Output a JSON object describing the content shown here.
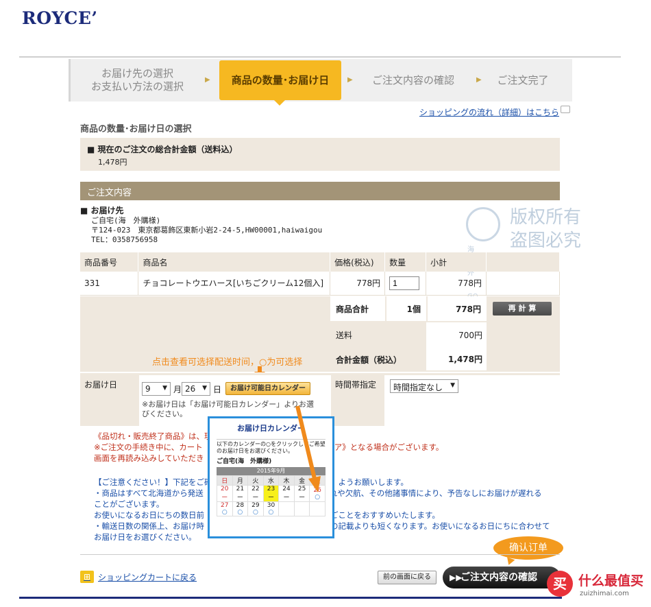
{
  "logo": "ROYCE’",
  "steps": {
    "s1_line1": "お届け先の選択",
    "s1_line2": "お支払い方法の選択",
    "s2": "商品の数量･お届け日",
    "s3": "ご注文内容の確認",
    "s4": "ご注文完了"
  },
  "flow_link": "ショッピングの流れ（詳細）はこちら",
  "section_title": "商品の数量･お届け日の選択",
  "total": {
    "heading": "■ 現在のご注文の総合計金額（送料込）",
    "value": "1,478円"
  },
  "order_heading": "ご注文内容",
  "destination": {
    "heading": "■ お届け先",
    "name": "ご自宅(海　外購様)",
    "address": "〒124-023　東京都葛飾区東新小岩2-24-5,HW00001,haiwaigou",
    "tel": "TEL：0358756958"
  },
  "watermark": {
    "line1": "版权所有",
    "line2": "盗图必究",
    "brand": "海外GO"
  },
  "table": {
    "headers": [
      "商品番号",
      "商品名",
      "価格(税込)",
      "数量",
      "小計"
    ],
    "row": {
      "code": "331",
      "name": "チョコレートウエハース[いちごクリーム12個入]",
      "price": "778円",
      "qty": "1",
      "subtotal": "778円"
    }
  },
  "summary": {
    "goods_label": "商品合計",
    "goods_qty": "1個",
    "goods_total": "778円",
    "recalc": "再 計 算",
    "shipping_label": "送料",
    "shipping": "700円",
    "grand_label": "合計金額（税込）",
    "grand": "1,478円"
  },
  "annotation": "点击查看可选择配送时间，○为可选择",
  "delivery": {
    "label": "お届け日",
    "month": "9",
    "month_unit": "月",
    "day": "26",
    "day_unit": "日",
    "cal_button": "お届け可能日カレンダー",
    "note": "※お届け日は「お届け可能日カレンダー」よりお選びください。",
    "time_label": "時間帯指定",
    "time_value": "時間指定なし"
  },
  "notes_red": [
    "《品切れ・販売終了商品》は、現",
    "※ご注文の手続き中に、カート",
    "画面を再読み込みしていただき"
  ],
  "notes_red_right": "ア》となる場合がございます。",
  "notes_blue": [
    "【ご注意ください！】下記をご確",
    "・商品はすべて北海道から発送",
    "ことがございます。",
    "お使いになるお日にちの数日前",
    "・輸送日数の関係上、お届け時",
    "お届け日をお選びください。"
  ],
  "notes_blue_right": [
    "ようお願いします。",
    "れや欠航、その他諸事情により、予告なしにお届けが遅れる",
    "",
    "ごことをおすすめいたします。",
    "の記載よりも短くなります。お使いになるお日にちに合わせて",
    ""
  ],
  "calendar": {
    "title": "お届け日カレンダー",
    "desc": "以下のカレンダーの○をクリックしてご希望のお届け日をお選びください。",
    "name": "ご自宅(海　外購様)",
    "month": "2015年9月",
    "dow": [
      "日",
      "月",
      "火",
      "水",
      "木",
      "金",
      "土"
    ],
    "week1": [
      "20",
      "21",
      "22",
      "23",
      "24",
      "25",
      "26"
    ],
    "week1_marks": [
      "ー",
      "ー",
      "ー",
      "ー",
      "ー",
      "ー",
      "○"
    ],
    "week2": [
      "27",
      "28",
      "29",
      "30",
      "",
      "",
      ""
    ],
    "week2_marks": [
      "○",
      "○",
      "○",
      "○",
      "",
      "",
      ""
    ]
  },
  "confirm_bubble": "确认订单",
  "cart_link": "ショッピングカートに戻る",
  "back_button": "前の画面に戻る",
  "confirm_button": "ご注文内容の確認",
  "smzdm": {
    "title": "什么最值买",
    "url": "zuizhimai.com",
    "mark": "买"
  },
  "colors": {
    "accent": "#f6b821",
    "brand": "#1c2b7a",
    "annotation": "#f08a1c",
    "panel": "#efe8de"
  }
}
